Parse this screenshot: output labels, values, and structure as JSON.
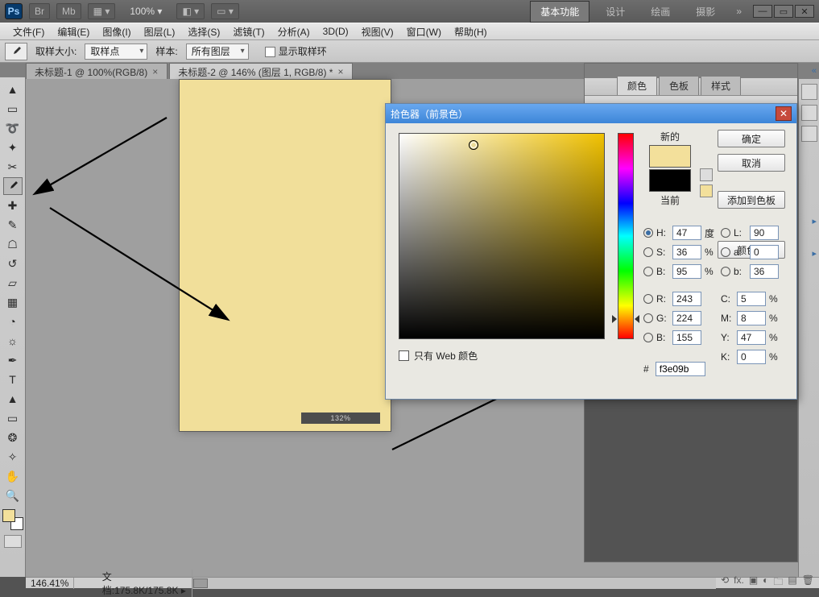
{
  "titlebar": {
    "ps": "Ps",
    "br": "Br",
    "mb": "Mb",
    "zoom": "100%"
  },
  "workspace": {
    "basic": "基本功能",
    "design": "设计",
    "paint": "绘画",
    "photo": "摄影",
    "more": "»"
  },
  "menus": [
    "文件(F)",
    "编辑(E)",
    "图像(I)",
    "图层(L)",
    "选择(S)",
    "滤镜(T)",
    "分析(A)",
    "3D(D)",
    "视图(V)",
    "窗口(W)",
    "帮助(H)"
  ],
  "optbar": {
    "sizeLabel": "取样大小:",
    "sizeValue": "取样点",
    "sampleLabel": "样本:",
    "sampleValue": "所有图层",
    "ringLabel": "显示取样环"
  },
  "tabs": {
    "t1": "未标题-1 @ 100%(RGB/8)",
    "t2": "未标题-2 @ 146% (图层 1, RGB/8) *"
  },
  "rpanel": {
    "color": "颜色",
    "swatches": "色板",
    "styles": "样式"
  },
  "status": {
    "zoom": "146.41%",
    "info": "文档:175.8K/175.8K"
  },
  "picker": {
    "title": "拾色器（前景色）",
    "newLabel": "新的",
    "curLabel": "当前",
    "ok": "确定",
    "cancel": "取消",
    "addSwatch": "添加到色板",
    "colorLib": "颜色库",
    "webOnly": "只有 Web 颜色",
    "hex": "f3e09b",
    "H": "47",
    "Hu": "度",
    "S": "36",
    "B": "95",
    "L": "90",
    "a": "0",
    "b2": "36",
    "R": "243",
    "G": "224",
    "Bv": "155",
    "C": "5",
    "M": "8",
    "Y": "47",
    "K": "0"
  },
  "canvas": {
    "stripLabel": "132% "
  }
}
